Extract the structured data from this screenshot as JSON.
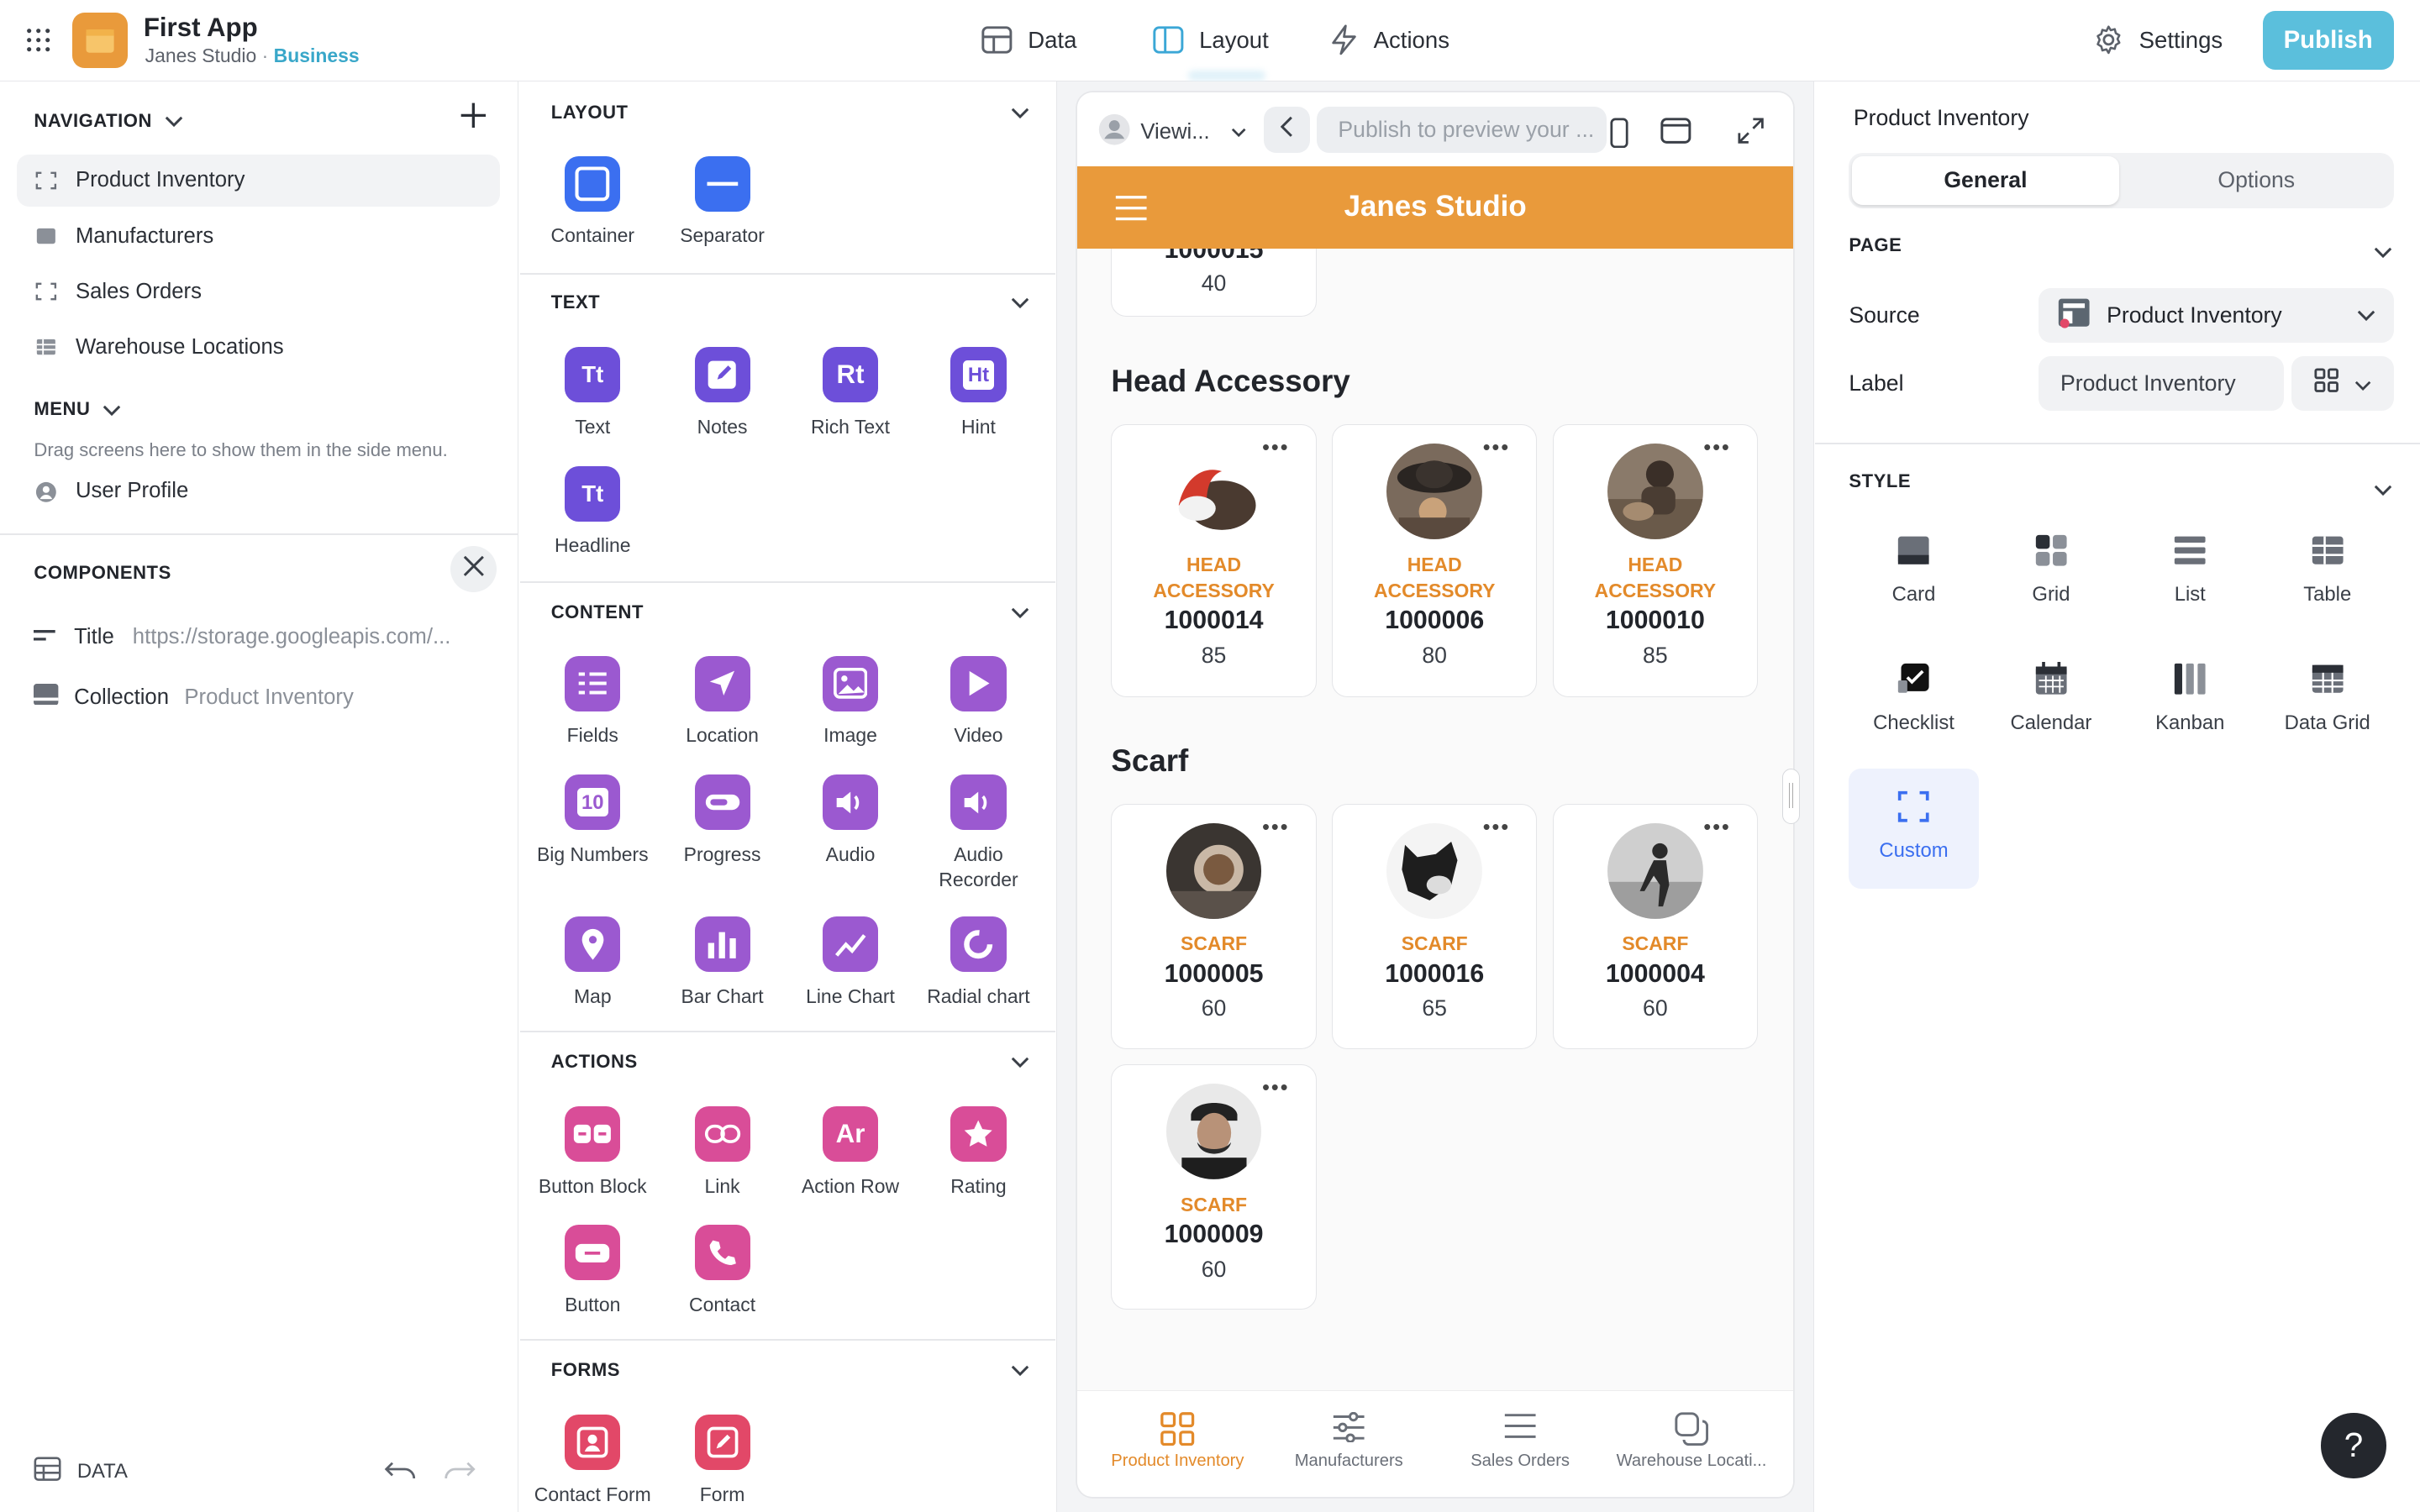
{
  "app": {
    "title": "First App",
    "owner": "Janes Studio",
    "sep": "·",
    "plan": "Business"
  },
  "topnav": {
    "data": "Data",
    "layout": "Layout",
    "actions": "Actions",
    "settings": "Settings",
    "publish": "Publish"
  },
  "navigation": {
    "header": "NAVIGATION",
    "items": [
      {
        "label": "Product Inventory"
      },
      {
        "label": "Manufacturers"
      },
      {
        "label": "Sales Orders"
      },
      {
        "label": "Warehouse Locations"
      }
    ]
  },
  "menu": {
    "header": "MENU",
    "hint": "Drag screens here to show them in the side menu.",
    "items": [
      {
        "label": "User Profile"
      }
    ]
  },
  "components": {
    "header": "COMPONENTS",
    "items": [
      {
        "type": "Title",
        "value": "https://storage.googleapis.com/..."
      },
      {
        "type": "Collection",
        "value": "Product Inventory"
      }
    ]
  },
  "footer_left": {
    "data": "DATA"
  },
  "library": {
    "layout": {
      "title": "LAYOUT",
      "items": [
        "Container",
        "Separator"
      ]
    },
    "text": {
      "title": "TEXT",
      "items": [
        "Text",
        "Notes",
        "Rich Text",
        "Hint",
        "Headline"
      ],
      "glyphs": [
        "Tt",
        "",
        "Rt",
        "Ht",
        "Tt"
      ]
    },
    "content": {
      "title": "CONTENT",
      "items": [
        "Fields",
        "Location",
        "Image",
        "Video",
        "Big Numbers",
        "Progress",
        "Audio",
        "Audio Recorder",
        "Map",
        "Bar Chart",
        "Line Chart",
        "Radial chart"
      ],
      "big_glyph": "10"
    },
    "actions": {
      "title": "ACTIONS",
      "items": [
        "Button Block",
        "Link",
        "Action Row",
        "Rating",
        "Button",
        "Contact"
      ],
      "glyph": "Ar"
    },
    "forms": {
      "title": "FORMS",
      "items": [
        "Contact Form",
        "Form Container"
      ]
    }
  },
  "preview": {
    "viewing": "Viewi...",
    "publish_placeholder": "Publish to preview your ...",
    "header_title": "Janes Studio",
    "partial_card": {
      "num": "1000015",
      "val": "40"
    },
    "groups": [
      {
        "title": "Head Accessory",
        "cards": [
          {
            "cat": "HEAD ACCESSORY",
            "num": "1000014",
            "val": "85"
          },
          {
            "cat": "HEAD ACCESSORY",
            "num": "1000006",
            "val": "80"
          },
          {
            "cat": "HEAD ACCESSORY",
            "num": "1000010",
            "val": "85"
          }
        ]
      },
      {
        "title": "Scarf",
        "cards": [
          {
            "cat": "SCARF",
            "num": "1000005",
            "val": "60"
          },
          {
            "cat": "SCARF",
            "num": "1000016",
            "val": "65"
          },
          {
            "cat": "SCARF",
            "num": "1000004",
            "val": "60"
          },
          {
            "cat": "SCARF",
            "num": "1000009",
            "val": "60"
          }
        ]
      }
    ],
    "tabs": [
      {
        "label": "Product Inventory"
      },
      {
        "label": "Manufacturers"
      },
      {
        "label": "Sales Orders"
      },
      {
        "label": "Warehouse Locati..."
      }
    ]
  },
  "inspector": {
    "title": "Product Inventory",
    "tabs": {
      "general": "General",
      "options": "Options"
    },
    "page": {
      "header": "PAGE",
      "source_label": "Source",
      "source_value": "Product Inventory",
      "label_label": "Label",
      "label_value": "Product Inventory"
    },
    "style": {
      "header": "STYLE",
      "options": [
        "Card",
        "Grid",
        "List",
        "Table",
        "Checklist",
        "Calendar",
        "Kanban",
        "Data Grid",
        "Custom"
      ],
      "selected": "Custom"
    }
  },
  "help": "?",
  "colors": {
    "accent": "#e99a3b",
    "publish": "#5bbfdc",
    "primary": "#3b6ff0",
    "text_purple": "#6d4fd9",
    "content_purple": "#9b59d0",
    "actions_pink": "#d94d98",
    "forms_red": "#e24868"
  }
}
